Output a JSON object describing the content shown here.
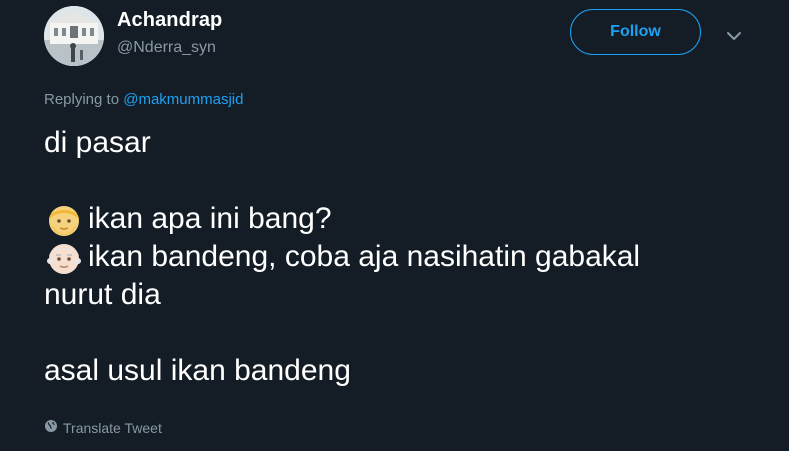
{
  "author": {
    "name": "Achandrap",
    "handle": "@Nderra_syn"
  },
  "follow_label": "Follow",
  "reply": {
    "prefix": "Replying to",
    "mention": "@makmummasjid"
  },
  "tweet": {
    "line1": "di pasar",
    "line2_icon": "blond-person-emoji",
    "line2_text": "ikan apa ini bang?",
    "line3_icon": "older-adult-emoji",
    "line3_text": "ikan bandeng, coba aja nasihatin gabakal",
    "line4": "nurut dia",
    "line5": "asal usul ikan bandeng"
  },
  "translate_label": "Translate Tweet",
  "colors": {
    "background": "#141d26",
    "accent": "#1da1f2",
    "secondary_text": "#8899a6"
  },
  "icons": [
    "chevron-down-icon",
    "globe-icon"
  ]
}
